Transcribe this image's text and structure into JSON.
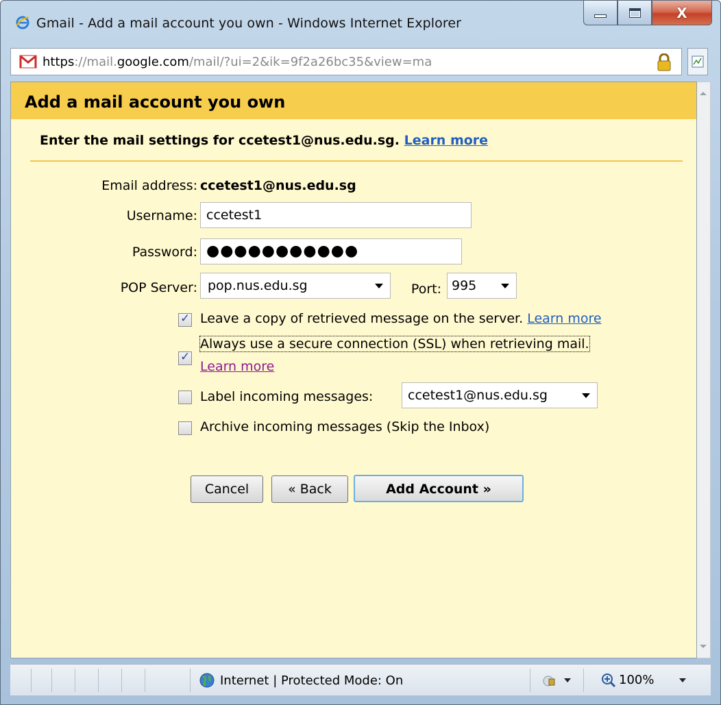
{
  "window": {
    "title": "Gmail - Add a mail account you own - Windows Internet Explorer",
    "close_glyph": "X"
  },
  "address_bar": {
    "scheme": "https",
    "separator": "://",
    "subdomain": "mail.",
    "domain": "google.com",
    "path": "/mail/?ui=2&ik=9f2a26bc35&view=ma"
  },
  "page": {
    "title": "Add a mail account you own",
    "subtitle": "Enter the mail settings for ccetest1@nus.edu.sg.",
    "subtitle_link": "Learn more"
  },
  "form": {
    "email_label": "Email address:",
    "email_value": "ccetest1@nus.edu.sg",
    "username_label": "Username:",
    "username_value": "ccetest1",
    "password_label": "Password:",
    "password_value": "●●●●●●●●●●●",
    "pop_server_label": "POP Server:",
    "pop_server_value": "pop.nus.edu.sg",
    "port_label": "Port:",
    "port_value": "995"
  },
  "options": {
    "leave_copy": {
      "label": "Leave a copy of retrieved message on the server.",
      "link": "Learn more",
      "checked": true
    },
    "ssl": {
      "label": "Always use a secure connection (SSL) when retrieving mail.",
      "link": "Learn more",
      "checked": true
    },
    "label_incoming": {
      "label": "Label incoming messages:",
      "value": "ccetest1@nus.edu.sg",
      "checked": false
    },
    "archive": {
      "label": "Archive incoming messages (Skip the Inbox)",
      "checked": false
    }
  },
  "buttons": {
    "cancel": "Cancel",
    "back": "« Back",
    "add_account": "Add Account »"
  },
  "status_bar": {
    "zone": "Internet | Protected Mode: On",
    "zoom": "100%"
  },
  "colors": {
    "header": "#f6cd4d",
    "panel": "#fff9cf",
    "link": "#1f5fbf",
    "visited_link": "#8e1a8e"
  }
}
